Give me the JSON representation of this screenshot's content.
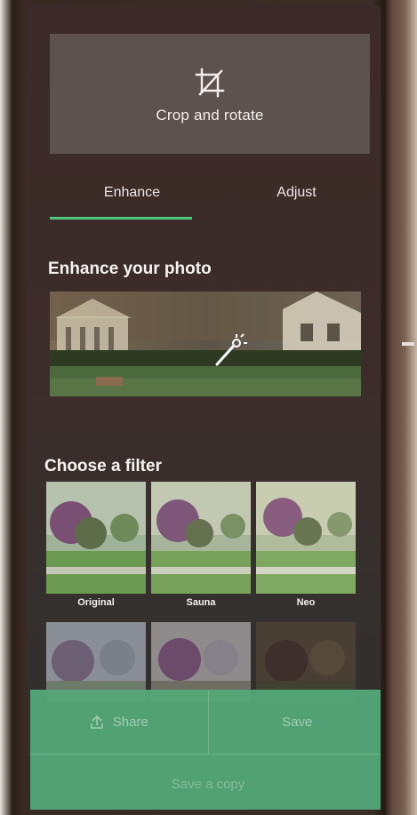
{
  "crop": {
    "label": "Crop and rotate",
    "icon": "crop-icon"
  },
  "tabs": [
    {
      "label": "Enhance",
      "selected": true
    },
    {
      "label": "Adjust",
      "selected": false
    }
  ],
  "enhance": {
    "title": "Enhance your photo",
    "icon": "magic-wand-icon"
  },
  "filters": {
    "title": "Choose a filter",
    "items": [
      {
        "label": "Original"
      },
      {
        "label": "Sauna"
      },
      {
        "label": "Neo"
      },
      {
        "label": ""
      },
      {
        "label": ""
      },
      {
        "label": ""
      }
    ]
  },
  "actions": {
    "share_label": "Share",
    "save_label": "Save",
    "save_copy_label": "Save a copy",
    "share_icon": "share-icon"
  },
  "colors": {
    "accent": "#4fc77d",
    "panel": "#3b2a27",
    "tile": "#5e5250",
    "action_bar": "#54a879"
  }
}
